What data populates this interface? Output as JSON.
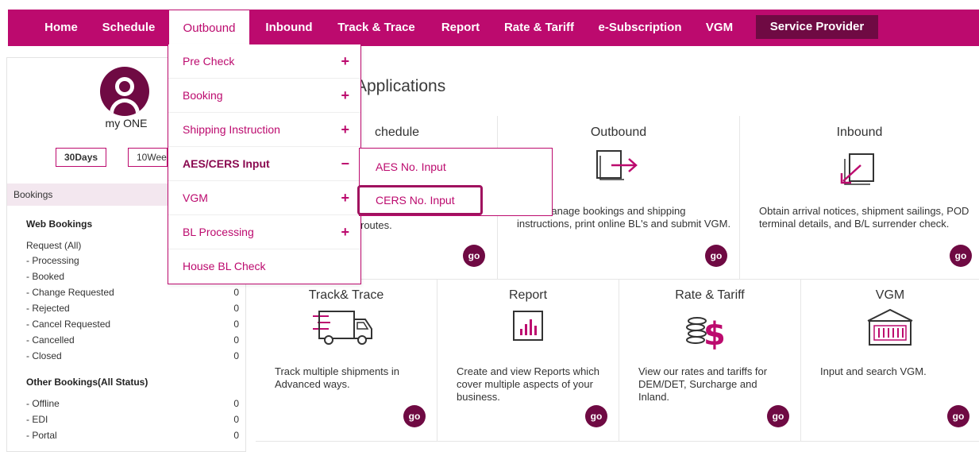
{
  "nav": {
    "items": [
      "Home",
      "Schedule",
      "Outbound",
      "Inbound",
      "Track & Trace",
      "Report",
      "Rate & Tariff",
      "e-Subscription",
      "VGM"
    ],
    "service_provider": "Service Provider"
  },
  "sidebar": {
    "user": "my ONE",
    "range_30": "30Days",
    "range_10": "10Wee",
    "bookings_header": "Bookings",
    "web_title": "Web Bookings",
    "web_rows": [
      {
        "label": "Request (All)",
        "count": ""
      },
      {
        "label": "- Processing",
        "count": ""
      },
      {
        "label": "- Booked",
        "count": ""
      },
      {
        "label": "- Change Requested",
        "count": "0"
      },
      {
        "label": "- Rejected",
        "count": "0"
      },
      {
        "label": "- Cancel Requested",
        "count": "0"
      },
      {
        "label": "- Cancelled",
        "count": "0"
      },
      {
        "label": "- Closed",
        "count": "0"
      }
    ],
    "other_title": "Other Bookings(All Status)",
    "other_rows": [
      {
        "label": "- Offline",
        "count": "0"
      },
      {
        "label": "- EDI",
        "count": "0"
      },
      {
        "label": "- Portal",
        "count": "0"
      }
    ]
  },
  "main": {
    "apps_title": "Applications",
    "cards": {
      "schedule": {
        "title": "chedule",
        "desc": "routes."
      },
      "outbound": {
        "title": "Outbound",
        "desc": "t and manage bookings and shipping instructions, print online BL's and submit VGM."
      },
      "inbound": {
        "title": "Inbound",
        "desc": "Obtain arrival notices, shipment sailings, POD terminal details, and B/L surrender check."
      },
      "track": {
        "title": "Track& Trace",
        "desc": "Track multiple shipments in Advanced ways."
      },
      "report": {
        "title": "Report",
        "desc": "Create and view Reports which cover multiple aspects of your business."
      },
      "rate": {
        "title": "Rate & Tariff",
        "desc": "View our rates and tariffs for DEM/DET, Surcharge and Inland."
      },
      "vgm": {
        "title": "VGM",
        "desc": "Input and search VGM."
      }
    },
    "go_label": "go"
  },
  "dropdown": {
    "items": [
      {
        "label": "Pre Check",
        "sign": "+"
      },
      {
        "label": "Booking",
        "sign": "+"
      },
      {
        "label": "Shipping Instruction",
        "sign": "+"
      },
      {
        "label": "AES/CERS Input",
        "sign": "−"
      },
      {
        "label": "VGM",
        "sign": "+"
      },
      {
        "label": "BL Processing",
        "sign": "+"
      },
      {
        "label": "House BL Check",
        "sign": ""
      }
    ],
    "submenu": [
      "AES No. Input",
      "CERS No. Input"
    ]
  },
  "colors": {
    "brand": "#bc0a6e",
    "dark": "#6f0a43"
  }
}
